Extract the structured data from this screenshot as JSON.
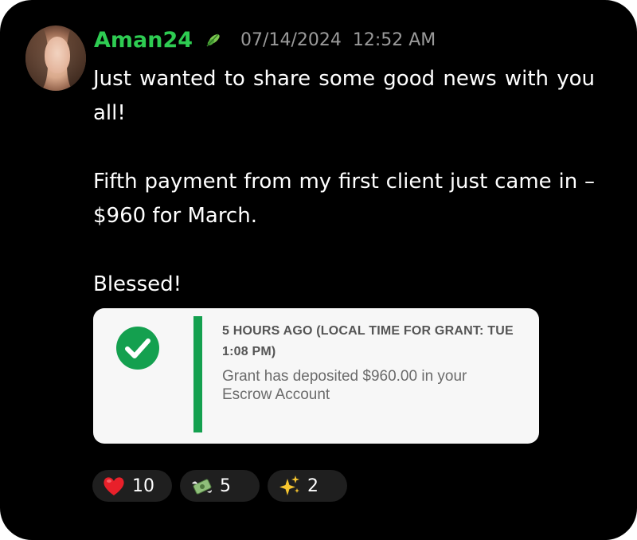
{
  "message": {
    "username": "Aman24",
    "username_color": "#2ecc52",
    "badge_icon": "leaf-badge-icon",
    "date": "07/14/2024",
    "time": "12:52 AM",
    "paragraphs": [
      "Just wanted to share some good news with you all!",
      "Fifth payment from my first client just came in – $960 for March.",
      "Blessed!"
    ]
  },
  "embed": {
    "icon": "check-circle-icon",
    "accent_color": "#14a04f",
    "title": "5 HOURS AGO (LOCAL TIME FOR GRANT: TUE 1:08 PM)",
    "body": "Grant has deposited $960.00 in your Escrow Account"
  },
  "reactions": [
    {
      "icon": "red-heart-icon",
      "count": "10"
    },
    {
      "icon": "money-with-wings-icon",
      "count": "5"
    },
    {
      "icon": "sparkles-icon",
      "count": "2"
    }
  ]
}
